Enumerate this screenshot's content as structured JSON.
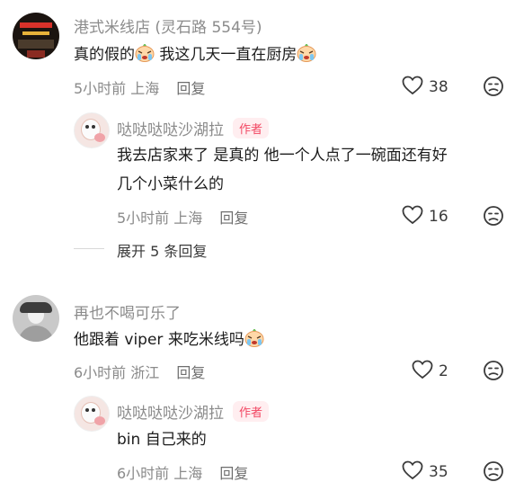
{
  "comments": [
    {
      "name": "港式米线店 (灵石路 554号)",
      "text_part1": "真的假的",
      "text_part2": " 我这几天一直在厨房",
      "time": "5小时前",
      "location": "上海",
      "reply_label": "回复",
      "likes": "38",
      "reply": {
        "name": "哒哒哒哒沙湖拉",
        "tag": "作者",
        "text_line1": "我去店家来了 是真的 他一个人点了一碗面还有好",
        "text_line2": "几个小菜什么的",
        "time": "5小时前",
        "location": "上海",
        "reply_label": "回复",
        "likes": "16"
      },
      "expand_label": "展开 5 条回复"
    },
    {
      "name": "再也不喝可乐了",
      "text_part1": "他跟着 viper 来吃米线吗",
      "time": "6小时前",
      "location": "浙江",
      "reply_label": "回复",
      "likes": "2",
      "reply": {
        "name": "哒哒哒哒沙湖拉",
        "tag": "作者",
        "text_line1": "bin 自己来的",
        "time": "6小时前",
        "location": "上海",
        "reply_label": "回复",
        "likes": "35"
      }
    }
  ],
  "icons": {
    "like": "heart-outline-icon",
    "dislike": "frown-face-icon",
    "emoji": "crying-emoji-icon"
  },
  "colors": {
    "author_tag_text": "#f24863",
    "author_tag_bg": "#ffeef0",
    "muted_text": "#8a8a8a"
  }
}
